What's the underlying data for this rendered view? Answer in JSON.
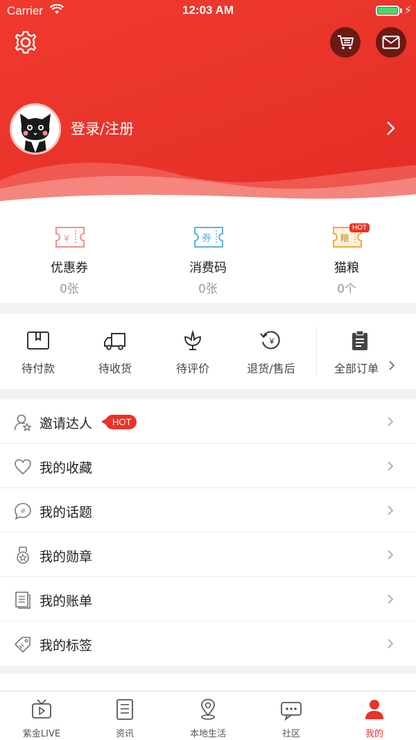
{
  "status_bar": {
    "carrier": "Carrier",
    "time": "12:03 AM"
  },
  "profile": {
    "login_label": "登录/注册"
  },
  "stats": [
    {
      "label": "优惠券",
      "count": "0张",
      "icon": "coupon-icon",
      "icon_text": "¥"
    },
    {
      "label": "消费码",
      "count": "0张",
      "icon": "voucher-icon",
      "icon_text": "券"
    },
    {
      "label": "猫粮",
      "count": "0个",
      "icon": "cat-food-icon",
      "icon_text": "粮",
      "badge": "HOT"
    }
  ],
  "orders": {
    "items": [
      {
        "label": "待付款",
        "icon": "wallet-icon"
      },
      {
        "label": "待收货",
        "icon": "truck-icon"
      },
      {
        "label": "待评价",
        "icon": "flower-icon"
      },
      {
        "label": "退货/售后",
        "icon": "refund-icon"
      }
    ],
    "all_label": "全部订单"
  },
  "menu": [
    {
      "label": "邀请达人",
      "icon": "invite-user-icon",
      "badge": "HOT"
    },
    {
      "label": "我的收藏",
      "icon": "heart-icon"
    },
    {
      "label": "我的话题",
      "icon": "topic-icon"
    },
    {
      "label": "我的勋章",
      "icon": "medal-icon"
    },
    {
      "label": "我的账单",
      "icon": "bill-icon"
    },
    {
      "label": "我的标签",
      "icon": "tag-icon"
    }
  ],
  "tabs": [
    {
      "label": "紫金LIVE",
      "icon": "tv-icon",
      "active": false
    },
    {
      "label": "资讯",
      "icon": "news-icon",
      "active": false
    },
    {
      "label": "本地生活",
      "icon": "location-icon",
      "active": false
    },
    {
      "label": "社区",
      "icon": "community-icon",
      "active": false
    },
    {
      "label": "我的",
      "icon": "user-icon",
      "active": true
    }
  ],
  "colors": {
    "brand": "#e8332a",
    "header": "#f03a2e",
    "inactive": "#555555"
  }
}
